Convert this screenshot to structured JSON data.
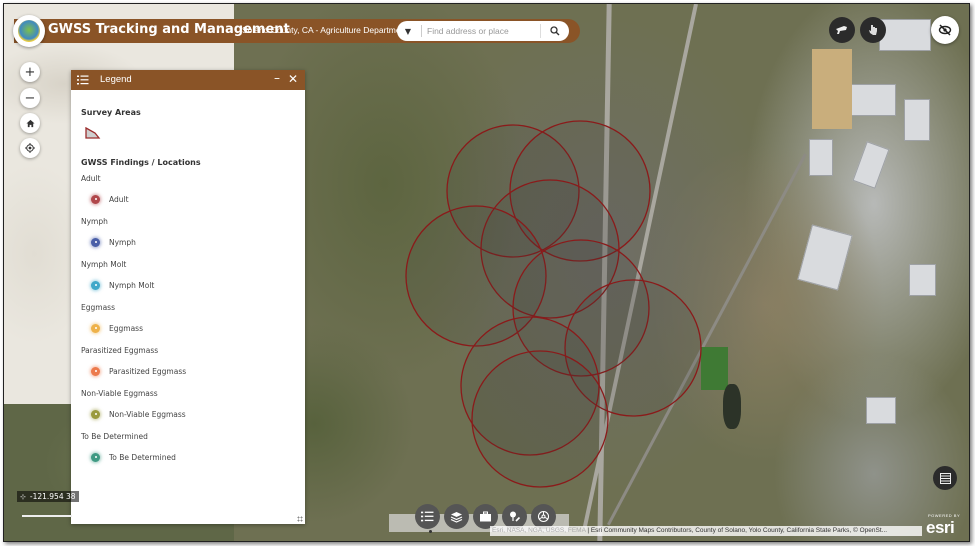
{
  "header": {
    "title": "GWSS Tracking and Management",
    "subtitle": "Solano County, CA - Agriculture Department",
    "logo_icon": "county-seal-logo"
  },
  "search": {
    "placeholder": "Find address or place",
    "value": "",
    "dropdown_icon": "caret-down-icon",
    "button_icon": "search-icon"
  },
  "map_nav": [
    {
      "name": "zoom-in-button",
      "icon": "plus-icon",
      "glyph": "+"
    },
    {
      "name": "zoom-out-button",
      "icon": "minus-icon",
      "glyph": "−"
    },
    {
      "name": "home-button",
      "icon": "home-icon",
      "glyph": "⌂"
    },
    {
      "name": "locate-button",
      "icon": "locate-icon",
      "glyph": "◎"
    }
  ],
  "top_right_buttons": [
    {
      "name": "draw-tool-button",
      "icon": "megaphone-icon",
      "style": "dark"
    },
    {
      "name": "measure-tool-button",
      "icon": "hand-pointer-icon",
      "style": "dark"
    },
    {
      "name": "hide-panels-button",
      "icon": "eye-off-icon",
      "style": "light"
    }
  ],
  "legend": {
    "title": "Legend",
    "minimize_glyph": "–",
    "close_glyph": "✕",
    "survey_areas": {
      "heading": "Survey Areas",
      "symbol_fill": "#cfcfcf",
      "symbol_stroke": "#9b2d2d"
    },
    "findings_heading": "GWSS Findings / Locations",
    "layers": [
      {
        "layer": "Adult",
        "label": "Adult",
        "color": "#b0474b"
      },
      {
        "layer": "Nymph",
        "label": "Nymph",
        "color": "#4a5fa8"
      },
      {
        "layer": "Nymph Molt",
        "label": "Nymph Molt",
        "color": "#41a8c9"
      },
      {
        "layer": "Eggmass",
        "label": "Eggmass",
        "color": "#eeb24a"
      },
      {
        "layer": "Parasitized Eggmass",
        "label": "Parasitized Eggmass",
        "color": "#ec7a4c"
      },
      {
        "layer": "Non-Viable Eggmass",
        "label": "Non-Viable Eggmass",
        "color": "#9a9a3e"
      },
      {
        "layer": "To Be Determined",
        "label": "To Be Determined",
        "color": "#3f9a83"
      }
    ]
  },
  "map": {
    "coordinates_readout": "-121.954 38",
    "survey_circle_color": "#8b1a1a",
    "survey_circles_count": 8
  },
  "widget_toolbar": [
    {
      "name": "legend-widget-button",
      "icon": "list-icon",
      "active": true
    },
    {
      "name": "layers-widget-button",
      "icon": "layers-icon",
      "active": false
    },
    {
      "name": "basemap-gallery-button",
      "icon": "briefcase-icon",
      "active": false
    },
    {
      "name": "draw-widget-button",
      "icon": "pin-pencil-icon",
      "active": false
    },
    {
      "name": "about-widget-button",
      "icon": "compass-icon",
      "active": false
    }
  ],
  "attribution": {
    "faded": "Esri, NASA, NGA, USGS, FEMA",
    "text": " | Esri Community Maps Contributors, County of Solano, Yolo County, California State Parks, © OpenSt..."
  },
  "esri_logo": {
    "powered_by": "POWERED BY",
    "brand": "esri"
  },
  "colors": {
    "brand_brown": "#8a5427",
    "button_dark": "#2b2b2b",
    "widget_gray": "#555555"
  }
}
